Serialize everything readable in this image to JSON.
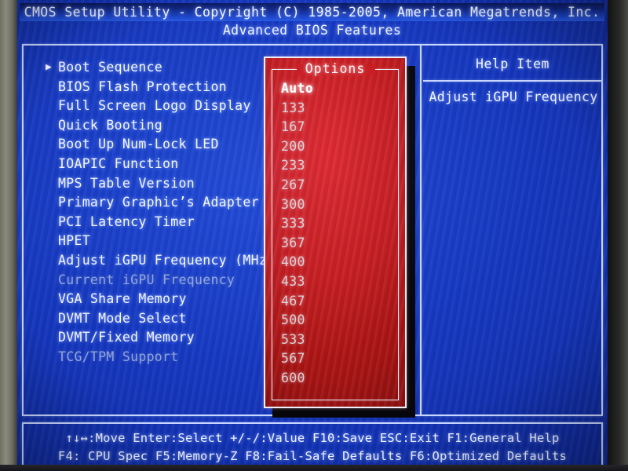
{
  "header": {
    "title": "CMOS Setup Utility - Copyright (C) 1985-2005, American Megatrends, Inc.",
    "subtitle": "Advanced BIOS Features"
  },
  "menu": {
    "items": [
      {
        "label": "Boot Sequence",
        "submenu_arrow": "▶",
        "dimmed": false
      },
      {
        "label": "BIOS Flash Protection",
        "submenu_arrow": "",
        "dimmed": false
      },
      {
        "label": "Full Screen Logo Display",
        "submenu_arrow": "",
        "dimmed": false
      },
      {
        "label": "Quick Booting",
        "submenu_arrow": "",
        "dimmed": false
      },
      {
        "label": "Boot Up Num-Lock LED",
        "submenu_arrow": "",
        "dimmed": false
      },
      {
        "label": "IOAPIC Function",
        "submenu_arrow": "",
        "dimmed": false
      },
      {
        "label": "MPS Table Version",
        "submenu_arrow": "",
        "dimmed": false
      },
      {
        "label": "Primary Graphic’s Adapter",
        "submenu_arrow": "",
        "dimmed": false
      },
      {
        "label": "PCI Latency Timer",
        "submenu_arrow": "",
        "dimmed": false
      },
      {
        "label": "HPET",
        "submenu_arrow": "",
        "dimmed": false
      },
      {
        "label": "Adjust iGPU Frequency (MHz)",
        "submenu_arrow": "",
        "dimmed": false
      },
      {
        "label": "Current iGPU Frequency",
        "submenu_arrow": "",
        "dimmed": true
      },
      {
        "label": "VGA Share Memory",
        "submenu_arrow": "",
        "dimmed": false
      },
      {
        "label": "DVMT Mode Select",
        "submenu_arrow": "",
        "dimmed": false
      },
      {
        "label": "DVMT/Fixed Memory",
        "submenu_arrow": "",
        "dimmed": false
      },
      {
        "label": "TCG/TPM Support",
        "submenu_arrow": "",
        "dimmed": true
      }
    ]
  },
  "options_popup": {
    "title": "Options",
    "selected": "Auto",
    "items": [
      "Auto",
      "133",
      "167",
      "200",
      "233",
      "267",
      "300",
      "333",
      "367",
      "400",
      "433",
      "467",
      "500",
      "533",
      "567",
      "600"
    ]
  },
  "help": {
    "title": "Help Item",
    "text": "Adjust iGPU Frequency"
  },
  "legend": {
    "line1": "↑↓↔:Move  Enter:Select  +/-/:Value  F10:Save  ESC:Exit  F1:General Help",
    "line2": "F4: CPU Spec   F5:Memory-Z   F8:Fail-Safe Defaults   F6:Optimized Defaults"
  },
  "colors": {
    "screen_blue": "#1536bd",
    "popup_red": "#c61a1a",
    "text_white": "#f2f5ff",
    "text_dim": "#93a5d8",
    "border": "#c9d6ff"
  }
}
